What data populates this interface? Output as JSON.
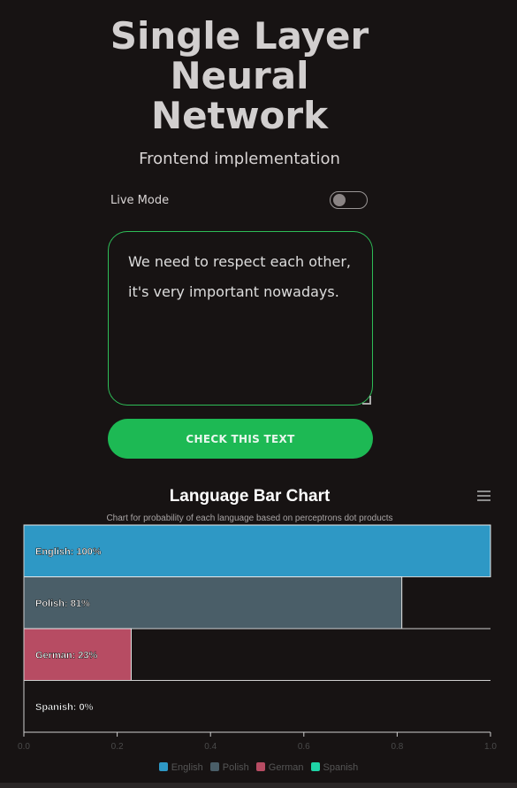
{
  "header": {
    "title": "Single Layer Neural Network",
    "subtitle": "Frontend implementation"
  },
  "live_mode": {
    "label": "Live Mode",
    "enabled": false
  },
  "input": {
    "value": "We need to respect each other, it's very important nowadays."
  },
  "check_button": {
    "label": "CHECK THIS TEXT"
  },
  "colors": {
    "accent": "#1db954",
    "english": "#2e98c5",
    "polish": "#4a5e68",
    "german": "#b74c63",
    "spanish": "#1fd3a6"
  },
  "chart_data": {
    "type": "bar",
    "orientation": "horizontal",
    "title": "Language Bar Chart",
    "subtitle": "Chart for probability of each language based on perceptrons dot products",
    "categories": [
      "English",
      "Polish",
      "German",
      "Spanish"
    ],
    "values": [
      1.0,
      0.81,
      0.23,
      0.0
    ],
    "data_labels": [
      "English: 100%",
      "Polish: 81%",
      "German: 23%",
      "Spanish: 0%"
    ],
    "xlim": [
      0,
      1
    ],
    "x_ticks": [
      "0.0",
      "0.2",
      "0.4",
      "0.6",
      "0.8",
      "1.0"
    ],
    "legend": [
      "English",
      "Polish",
      "German",
      "Spanish"
    ],
    "legend_placement": "bottom",
    "grid": false
  }
}
